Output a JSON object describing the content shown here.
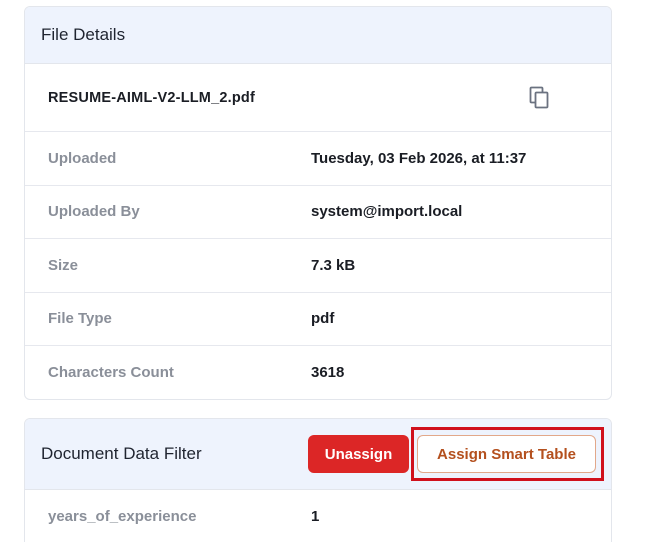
{
  "file_details": {
    "title": "File Details",
    "file_name": "RESUME-AIML-V2-LLM_2.pdf",
    "copy_icon": "copy-icon",
    "rows": [
      {
        "label": "Uploaded",
        "value": "Tuesday, 03 Feb 2026, at 11:37"
      },
      {
        "label": "Uploaded By",
        "value": "system@import.local"
      },
      {
        "label": "Size",
        "value": "7.3 kB"
      },
      {
        "label": "File Type",
        "value": "pdf"
      },
      {
        "label": "Characters Count",
        "value": "3618"
      }
    ]
  },
  "document_filter": {
    "title": "Document Data Filter",
    "unassign_label": "Unassign",
    "assign_label": "Assign Smart Table",
    "rows": [
      {
        "label": "years_of_experience",
        "value": "1"
      }
    ]
  },
  "colors": {
    "header_bg": "#eef3fd",
    "danger": "#dc2626",
    "accent_text": "#b4501e",
    "highlight": "#d0101c"
  }
}
